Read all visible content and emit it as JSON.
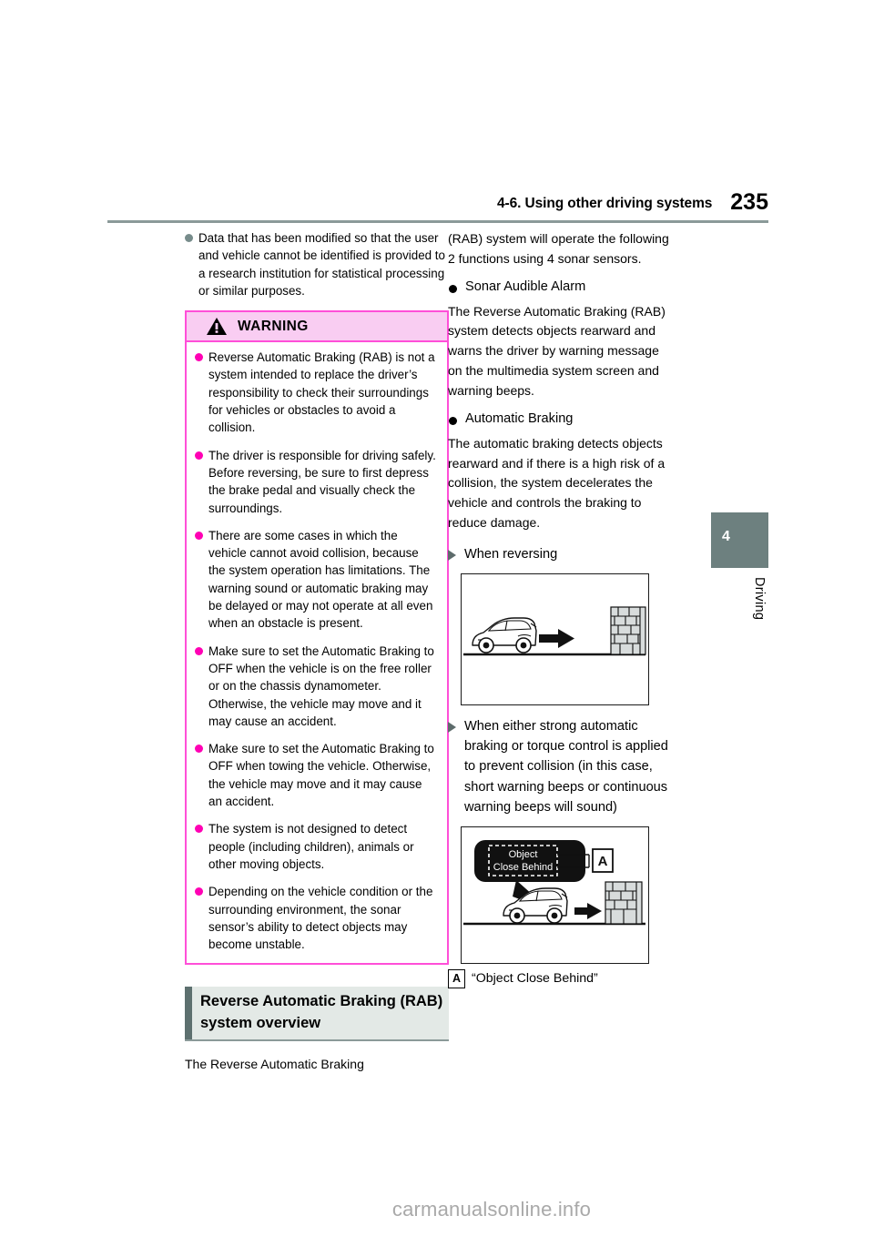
{
  "header": {
    "title": "4-6. Using other driving systems",
    "page_number": "235"
  },
  "chapter_tab": {
    "number": "4",
    "label": "Driving"
  },
  "left_column": {
    "intro_bullets": [
      "Data that has been modified so that the user and vehicle cannot be identified is provided to a research institution for statistical processing or similar purposes."
    ],
    "warning": {
      "title": "WARNING",
      "icon": "warning-triangle-icon",
      "items": [
        "Reverse Automatic Braking (RAB) is not a system intended to replace the driver’s responsibility to check their surroundings for vehicles or obstacles to avoid a collision.",
        "The driver is responsible for driving safely. Before reversing, be sure to first depress the brake pedal and visually check the surroundings.",
        "There are some cases in which the vehicle cannot avoid collision, because the system operation has limitations. The warning sound or automatic braking may be delayed or may not operate at all even when an obstacle is present.",
        "Make sure to set the Automatic Braking to OFF when the vehicle is on the free roller or on the chassis dynamometer. Otherwise, the vehicle may move and it may cause an accident.",
        "Make sure to set the Automatic Braking to OFF when towing the vehicle. Otherwise, the vehicle may move and it may cause an accident.",
        "The system is not designed to detect people (including children), animals or other moving objects.",
        "Depending on the vehicle condition or the surrounding environment, the sonar sensor’s ability to detect objects may become unstable."
      ]
    },
    "section_heading": "Reverse Automatic Braking (RAB) system overview",
    "section_intro": "The Reverse Automatic Braking"
  },
  "right_column": {
    "continuation": "(RAB) system will operate the following 2 functions using 4 sonar sensors.",
    "feature_1": {
      "heading": "Sonar Audible Alarm",
      "body": "The Reverse Automatic Braking (RAB) system detects objects rearward and warns the driver by warning message on the multimedia system screen and warning beeps."
    },
    "feature_2": {
      "heading": "Automatic Braking",
      "body": "The automatic braking detects objects rearward and if there is a high risk of a collision, the system decelerates the vehicle and controls the braking to reduce damage."
    },
    "figure_1": {
      "heading": "When reversing",
      "alt": "car-reversing-toward-wall-illustration"
    },
    "figure_2": {
      "heading": "When either strong automatic braking or torque control is applied to prevent collision (in this case, short warning beeps or continuous warning beeps will sound)",
      "alt": "car-reversing-with-screen-message-illustration",
      "screen_message_line_1": "Object",
      "screen_message_line_2": "Close Behind",
      "callout_marker": "A"
    },
    "caption": {
      "marker": "A",
      "text": "“Object Close Behind”"
    }
  },
  "watermark": "carmanualsonline.info",
  "colors": {
    "rule": "#8b9a99",
    "warning_border": "#ff4fd8",
    "warning_header_bg": "#f9cdf2",
    "warning_bullet": "#ff00b4",
    "gray_bullet": "#778c8b",
    "section_bar": "#5d706f",
    "section_bg": "#e3e9e6",
    "chapter_tab": "#6d807f",
    "watermark": "#a9a9a9"
  }
}
